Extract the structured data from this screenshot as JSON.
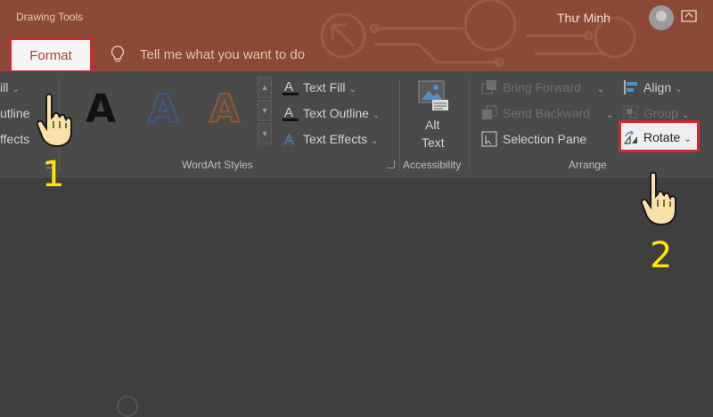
{
  "titlebar": {
    "context_label": "Drawing Tools",
    "user_name": "Thư Minh",
    "active_tab": "Format",
    "tell_me_placeholder": "Tell me what you want to do"
  },
  "ribbon": {
    "shape_styles_partial": {
      "fill": "ill",
      "outline": "utline",
      "effects": "ffects"
    },
    "wordart": {
      "text_fill": "Text Fill",
      "text_outline": "Text Outline",
      "text_effects": "Text Effects",
      "group_label": "WordArt Styles",
      "letter": "A"
    },
    "accessibility": {
      "alt_text_line1": "Alt",
      "alt_text_line2": "Text",
      "group_label": "Accessibility"
    },
    "arrange": {
      "bring_forward": "Bring Forward",
      "send_backward": "Send Backward",
      "selection_pane": "Selection Pane",
      "align": "Align",
      "group": "Group",
      "rotate": "Rotate",
      "group_label": "Arrange"
    }
  },
  "annotations": {
    "step1": "1",
    "step2": "2"
  },
  "colors": {
    "titlebar": "#8a4a35",
    "highlight": "#d12a2a",
    "step_number": "#ffe500"
  }
}
